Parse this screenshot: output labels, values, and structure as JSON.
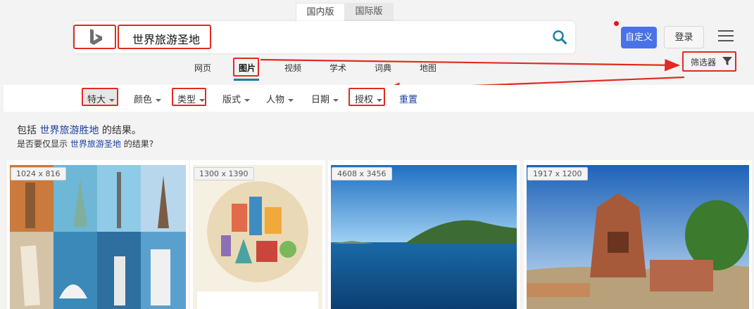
{
  "region_tabs": {
    "domestic": "国内版",
    "international": "国际版"
  },
  "search": {
    "query": "世界旅游圣地"
  },
  "header": {
    "customize_label": "自定义",
    "login_label": "登录"
  },
  "vertical_tabs": [
    "网页",
    "图片",
    "视频",
    "学术",
    "词典",
    "地图"
  ],
  "filter_toggle_label": "筛选器",
  "filters": [
    "特大",
    "颜色",
    "类型",
    "版式",
    "人物",
    "日期",
    "授权"
  ],
  "filter_reset": "重置",
  "results": {
    "include_prefix": "包括",
    "include_term": "世界旅游胜地",
    "include_suffix": "的结果。",
    "only_prefix": "是否要仅显示",
    "only_term": "世界旅游圣地",
    "only_suffix": "的结果?"
  },
  "images": [
    {
      "size": "1024 x 816"
    },
    {
      "size": "1300 x 1390"
    },
    {
      "size": "4608 x 3456"
    },
    {
      "size": "1917 x 1200"
    }
  ],
  "colors": {
    "highlight": "#e12b22",
    "accent": "#177f9e",
    "link": "#1a3fa0",
    "customize_bg": "#4a72e8"
  }
}
